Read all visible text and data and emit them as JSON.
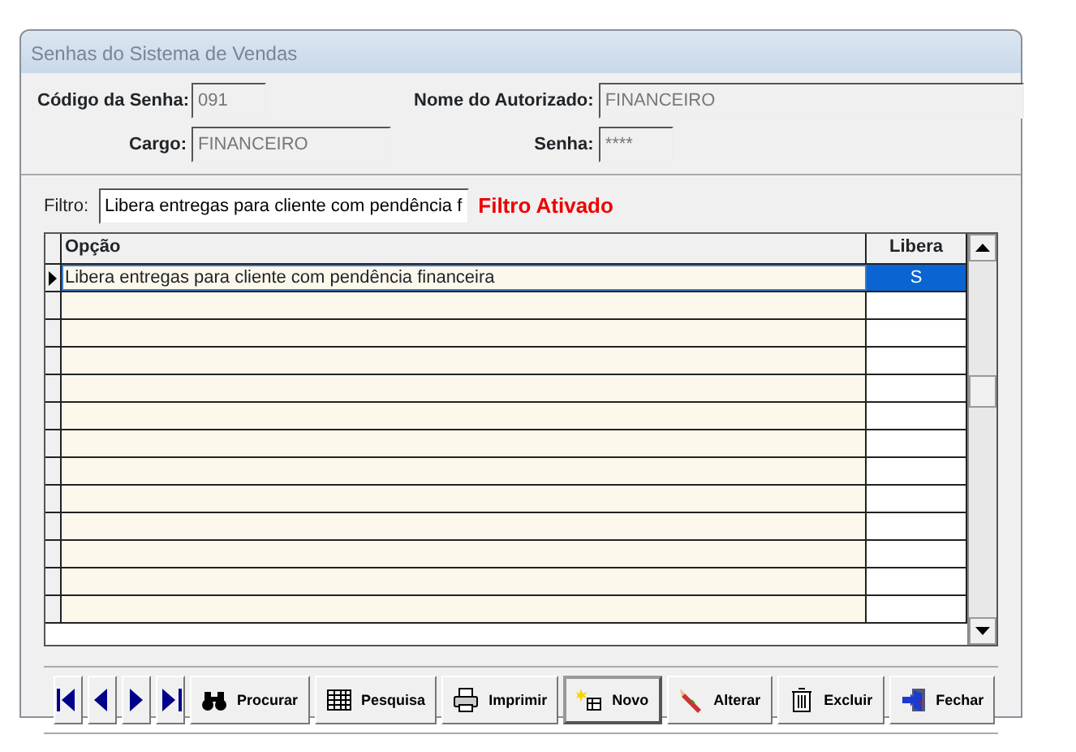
{
  "window": {
    "title": "Senhas do Sistema de Vendas"
  },
  "fields": [
    {
      "label": "Código da Senha:",
      "value": "091",
      "disabled": true
    },
    {
      "label": "Nome do Autorizado:",
      "value": "FINANCEIRO",
      "disabled": true
    },
    {
      "label": "Cargo:",
      "value": "FINANCEIRO",
      "disabled": true
    },
    {
      "label": "Senha:",
      "value": "****",
      "disabled": true
    }
  ],
  "filter": {
    "label": "Filtro:",
    "value": "Libera entregas para cliente com pendência f",
    "status": "Filtro Ativado"
  },
  "table": {
    "columns": [
      "Opção",
      "Libera"
    ],
    "rows": [
      {
        "cells": [
          "Libera entregas para cliente com pendência financeira",
          "S"
        ],
        "selected": true
      }
    ]
  },
  "navigation": [
    {
      "kind": "first"
    },
    {
      "kind": "prev"
    },
    {
      "kind": "next"
    },
    {
      "kind": "last"
    }
  ],
  "buttons": [
    {
      "label": "Procurar",
      "kind": "binoculars",
      "focused": false
    },
    {
      "label": "Pesquisa",
      "kind": "grid",
      "focused": false
    },
    {
      "label": "Imprimir",
      "kind": "printer",
      "focused": false
    },
    {
      "label": "Novo",
      "kind": "new",
      "focused": true
    },
    {
      "label": "Alterar",
      "kind": "pencil",
      "focused": false
    },
    {
      "label": "Excluir",
      "kind": "trash",
      "focused": false
    },
    {
      "label": "Fechar",
      "kind": "exit",
      "focused": false
    }
  ]
}
